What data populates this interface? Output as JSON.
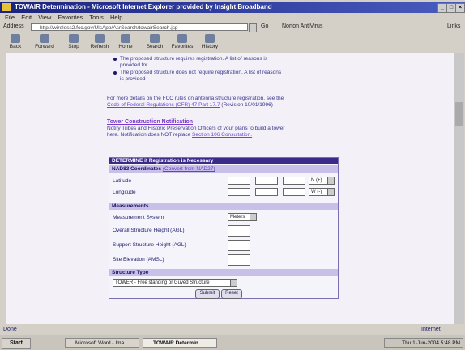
{
  "window": {
    "title": "TOWAIR Determination - Microsoft Internet Explorer provided by Insight Broadband",
    "controls": [
      "_",
      "□",
      "×"
    ]
  },
  "menu": [
    "File",
    "Edit",
    "View",
    "Favorites",
    "Tools",
    "Help"
  ],
  "address": {
    "label": "Address",
    "url": "http://wireless2.fcc.gov/UlsApp/AsrSearch/towairSearch.jsp",
    "go_label": "Go",
    "links_label": "Norton AntiVirus",
    "links2_label": "Links"
  },
  "toolbar": [
    "Back",
    "Forward",
    "Stop",
    "Refresh",
    "Home",
    "Search",
    "Favorites",
    "History"
  ],
  "content": {
    "bullet1_line1": "The proposed structure requires registration. A list of reasons is",
    "bullet1_line2": "provided for",
    "bullet2_line1": "The proposed structure does not require registration. A list of reasons",
    "bullet2_line2": "is provided",
    "para_line1": "For more details on the FCC rules on antenna structure registration, see the",
    "para_link": "Code of Federal Regulations (CFR) 47 Part 17.7",
    "para_tail": " (Revision 10/01/1996)",
    "tower_heading": "Tower Construction Notification",
    "tower_line1": "Notify Tribes and Historic Preservation Officers of your plans to build a tower",
    "tower_line2_prefix": "here. Notification does NOT replace ",
    "tower_line2_link": "Section 106 Consultation."
  },
  "form": {
    "title": "DETERMINE if Registration is Necessary",
    "nad_heading": "NAD83 Coordinates",
    "nad_convert": "(Convert from NAD27)",
    "latitude_label": "Latitude",
    "longitude_label": "Longitude",
    "lat_dir": "N (+)",
    "lon_dir": "W (-)",
    "measurements_heading": "Measurements",
    "measurement_system_label": "Measurement System",
    "measurement_system_value": "Meters",
    "overall_height_label": "Overall Structure Height (AGL)",
    "support_height_label": "Support Structure Height (AGL)",
    "site_elevation_label": "Site Elevation (AMSL)",
    "structure_type_heading": "Structure Type",
    "structure_type_value": "TOWER - Free standing or Guyed Structure",
    "submit_label": "Submit",
    "reset_label": "Reset"
  },
  "status": {
    "left": "Done",
    "zone": "Internet"
  },
  "taskbar": {
    "start": "Start",
    "task1": "Microsoft Word - Ima...",
    "task2": "TOWAIR Determin...",
    "clock": "Thu 1-Jun-2004 5:48 PM"
  }
}
